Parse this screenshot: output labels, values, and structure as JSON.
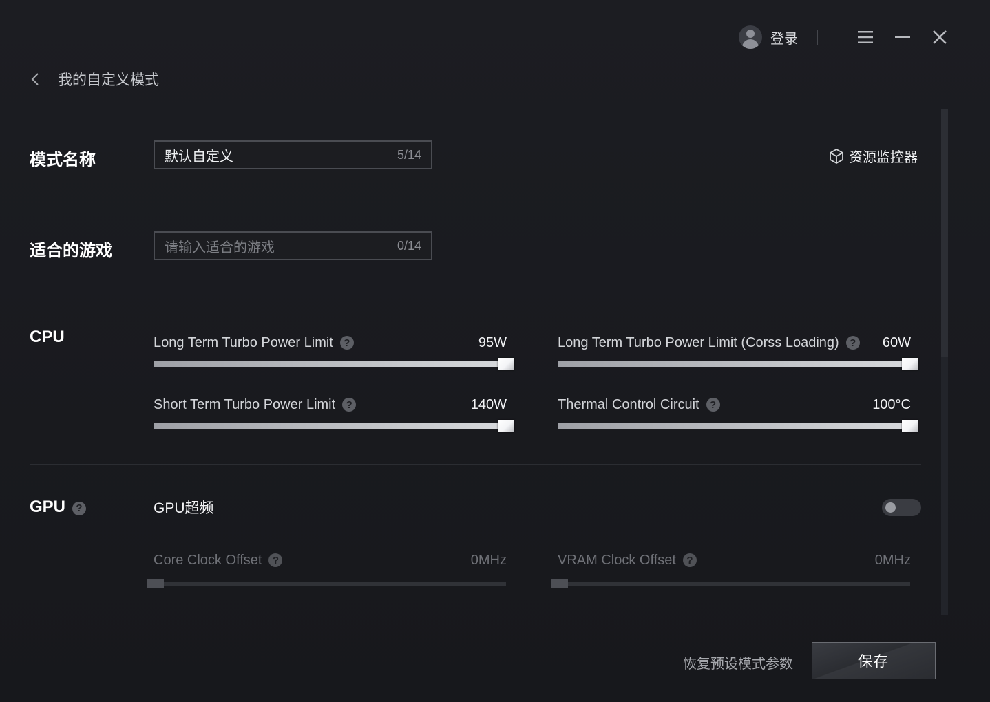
{
  "titlebar": {
    "login_label": "登录",
    "icons": [
      "avatar-icon",
      "menu-icon",
      "minimize-icon",
      "close-icon"
    ]
  },
  "header": {
    "back_label": "我的自定义模式"
  },
  "mode_name": {
    "label": "模式名称",
    "value": "默认自定义",
    "count": "5/14"
  },
  "suitable_games": {
    "label": "适合的游戏",
    "placeholder": "请输入适合的游戏",
    "count": "0/14"
  },
  "resource_monitor": {
    "label": "资源监控器",
    "icon": "cube-icon"
  },
  "cpu": {
    "title": "CPU",
    "sliders": [
      {
        "label": "Long Term Turbo Power Limit",
        "value": "95W",
        "level": 1.0
      },
      {
        "label": "Long Term Turbo Power Limit (Corss Loading)",
        "value": "60W",
        "level": 1.0
      },
      {
        "label": "Short Term Turbo Power Limit",
        "value": "140W",
        "level": 1.0
      },
      {
        "label": "Thermal Control Circuit",
        "value": "100°C",
        "level": 1.0
      }
    ]
  },
  "gpu": {
    "title": "GPU",
    "overclock_label": "GPU超频",
    "overclock_enabled": false,
    "sliders": [
      {
        "label": "Core Clock Offset",
        "value": "0MHz",
        "level": 0.0
      },
      {
        "label": "VRAM Clock Offset",
        "value": "0MHz",
        "level": 0.0
      }
    ]
  },
  "footer": {
    "reset_label": "恢复预设模式参数",
    "save_label": "保存"
  },
  "colors": {
    "background": "#18191d",
    "text_primary": "#ffffff",
    "text_muted": "#6f7177",
    "slider_fill": "#d7d9dc"
  }
}
